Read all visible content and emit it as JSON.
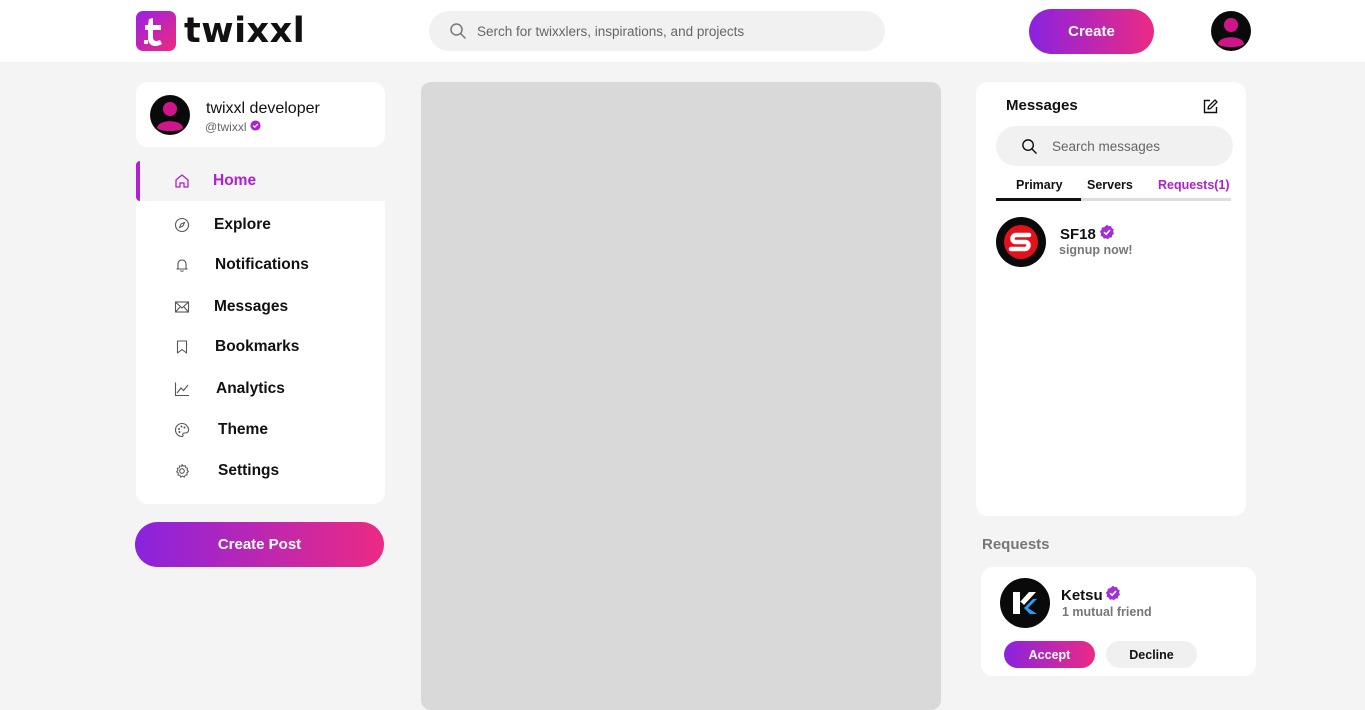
{
  "app": {
    "name": "twixxl",
    "accent_from": "#8a23e0",
    "accent_to": "#ec2a83",
    "accent_text": "#b01fd0"
  },
  "header": {
    "search_placeholder": "Serch for twixxlers, inspirations, and projects",
    "create_label": "Create"
  },
  "profile": {
    "name": "twixxl developer",
    "handle": "@twixxl",
    "verified_icon": "verified-badge-icon"
  },
  "sidebar": {
    "items": [
      {
        "label": "Home",
        "icon": "home-icon",
        "active": true
      },
      {
        "label": "Explore",
        "icon": "compass-icon"
      },
      {
        "label": "Notifications",
        "icon": "bell-icon"
      },
      {
        "label": "Messages",
        "icon": "envelope-icon"
      },
      {
        "label": "Bookmarks",
        "icon": "bookmark-icon"
      },
      {
        "label": "Analytics",
        "icon": "chart-icon"
      },
      {
        "label": "Theme",
        "icon": "palette-icon"
      },
      {
        "label": "Settings",
        "icon": "gear-icon"
      }
    ],
    "create_post_label": "Create Post"
  },
  "messages": {
    "title": "Messages",
    "search_placeholder": "Search messages",
    "tabs": {
      "primary": "Primary",
      "servers": "Servers",
      "requests": "Requests(1)"
    },
    "conversations": [
      {
        "name": "SF18",
        "preview": "signup now!",
        "verified": true
      }
    ]
  },
  "requests": {
    "heading": "Requests",
    "items": [
      {
        "name": "Ketsu",
        "mutual": "1 mutual friend",
        "verified": true,
        "accept_label": "Accept",
        "decline_label": "Decline"
      }
    ]
  }
}
